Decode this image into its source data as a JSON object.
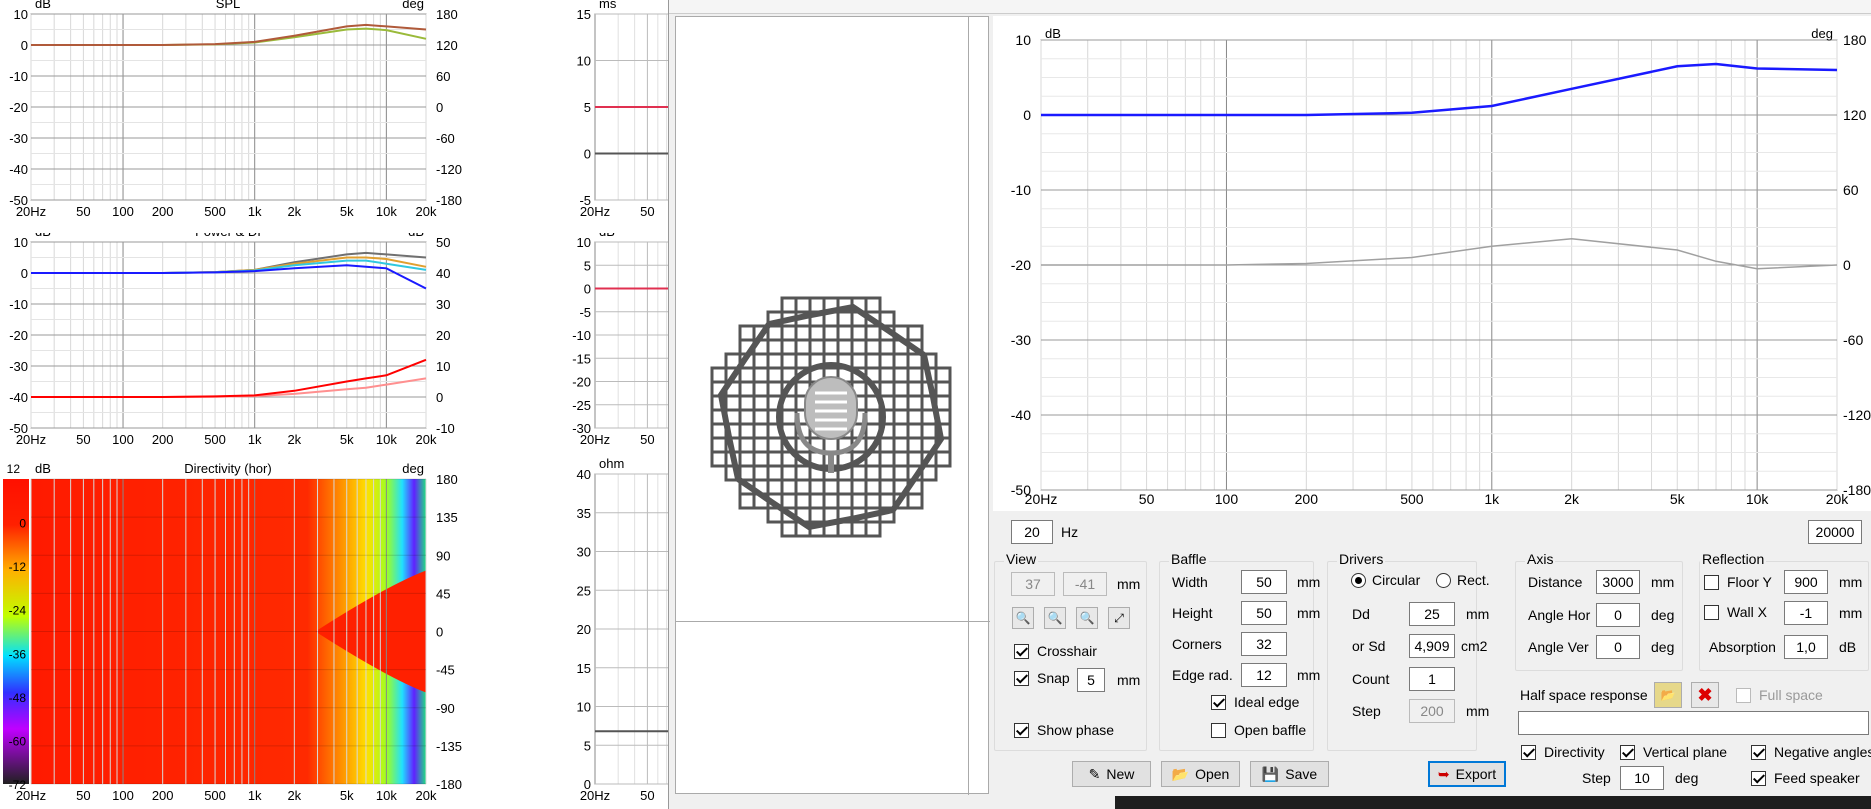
{
  "left_panels": {
    "spl": {
      "title": "SPL",
      "ylabel_left": "dB",
      "ylabel_right": "deg",
      "ylim": [
        -50,
        10
      ],
      "y_ticks": [
        "10",
        "0",
        "-10",
        "-20",
        "-30",
        "-40",
        "-50"
      ],
      "y2_ticks": [
        "180",
        "120",
        "60",
        "0",
        "-60",
        "-120",
        "-180"
      ],
      "x_ticks": [
        "20Hz",
        "50",
        "100",
        "200",
        "500",
        "1k",
        "2k",
        "5k",
        "10k",
        "20k"
      ]
    },
    "power": {
      "title": "Power & DI",
      "ylabel_left": "dB",
      "ylabel_right": "dB",
      "y_ticks": [
        "10",
        "0",
        "-10",
        "-20",
        "-30",
        "-40",
        "-50"
      ],
      "y2_ticks": [
        "50",
        "40",
        "30",
        "20",
        "10",
        "0",
        "-10"
      ],
      "x_ticks": [
        "20Hz",
        "50",
        "100",
        "200",
        "500",
        "1k",
        "2k",
        "5k",
        "10k",
        "20k"
      ]
    },
    "directivity": {
      "title": "Directivity (hor)",
      "ylabel_left": "dB",
      "ylabel_right": "deg",
      "scale_ticks": [
        "12",
        "0",
        "-12",
        "-24",
        "-36",
        "-48",
        "-60",
        "-72"
      ],
      "y2_ticks": [
        "180",
        "135",
        "90",
        "45",
        "0",
        "-45",
        "-90",
        "-135",
        "-180"
      ],
      "x_ticks": [
        "20Hz",
        "50",
        "100",
        "200",
        "500",
        "1k",
        "2k",
        "5k",
        "10k",
        "20k"
      ]
    },
    "group_delay": {
      "ylabel": "ms",
      "y_ticks": [
        "15",
        "10",
        "5",
        "0",
        "-5"
      ],
      "x_ticks": [
        "20Hz",
        "50"
      ]
    },
    "step": {
      "ylabel": "dB",
      "y_ticks": [
        "10",
        "5",
        "0",
        "-5",
        "-10",
        "-15",
        "-20",
        "-25",
        "-30"
      ],
      "x_ticks": [
        "20Hz",
        "50"
      ]
    },
    "impedance": {
      "ylabel": "ohm",
      "y_ticks": [
        "40",
        "35",
        "30",
        "25",
        "20",
        "15",
        "10",
        "5",
        "0"
      ],
      "x_ticks": [
        "20Hz",
        "50"
      ]
    }
  },
  "chart_data": [
    {
      "type": "line",
      "title": "SPL",
      "ylabel": "dB",
      "ylim": [
        -50,
        10
      ],
      "x": [
        20,
        50,
        100,
        200,
        500,
        1000,
        2000,
        5000,
        7000,
        10000,
        20000
      ],
      "series": [
        {
          "values": [
            0,
            0,
            0,
            0,
            0.3,
            1,
            3,
            6,
            6.5,
            6,
            5
          ]
        },
        {
          "values": [
            0,
            0,
            0,
            0,
            0.2,
            0.8,
            2.5,
            5,
            5.3,
            4.8,
            2
          ]
        }
      ]
    },
    {
      "type": "line",
      "title": "Power & DI",
      "ylabel": "dB",
      "ylim": [
        -50,
        10
      ],
      "x": [
        20,
        50,
        100,
        200,
        500,
        1000,
        2000,
        5000,
        7000,
        10000,
        20000
      ],
      "series": [
        {
          "values": [
            0,
            0,
            0,
            0,
            0.3,
            1,
            3,
            5,
            5,
            4.5,
            4
          ]
        },
        {
          "values": [
            0,
            0,
            0,
            0,
            0.2,
            0.6,
            1.5,
            2.5,
            2,
            1.5,
            -5
          ]
        },
        {
          "values": [
            -40,
            -40,
            -40,
            -40,
            -39.8,
            -39.5,
            -38,
            -35,
            -34,
            -33,
            -28
          ]
        }
      ]
    },
    {
      "type": "line",
      "ylabel": "dB",
      "ylim": [
        -50,
        10
      ],
      "x": [
        20,
        50,
        100,
        200,
        500,
        1000,
        2000,
        5000,
        7000,
        10000,
        20000
      ],
      "series": [
        {
          "values": [
            0,
            0,
            0,
            0,
            0.3,
            1.2,
            3.5,
            6.5,
            6.8,
            6.2,
            6
          ]
        },
        {
          "values": [
            -20,
            -20,
            -20,
            -19.8,
            -19,
            -17.5,
            -16.5,
            -18,
            -19.5,
            -20.5,
            -20
          ]
        }
      ]
    }
  ],
  "main_chart": {
    "ylabel_left": "dB",
    "ylabel_right": "deg",
    "y_ticks": [
      "10",
      "0",
      "-10",
      "-20",
      "-30",
      "-40",
      "-50"
    ],
    "y2_ticks": [
      "180",
      "120",
      "60",
      "0",
      "-60",
      "-120",
      "-180"
    ],
    "x_ticks": [
      "20Hz",
      "50",
      "100",
      "200",
      "500",
      "1k",
      "2k",
      "5k",
      "10k",
      "20k"
    ]
  },
  "freq": {
    "min": "20",
    "max": "20000",
    "unit": "Hz"
  },
  "view": {
    "title": "View",
    "x": "37",
    "y": "-41",
    "unit": "mm",
    "crosshair": "Crosshair",
    "snap": "Snap",
    "snap_val": "5",
    "snap_unit": "mm",
    "show_phase": "Show phase"
  },
  "baffle": {
    "title": "Baffle",
    "width_lbl": "Width",
    "width": "50",
    "height_lbl": "Height",
    "height": "50",
    "corners_lbl": "Corners",
    "corners": "32",
    "edge_lbl": "Edge rad.",
    "edge": "12",
    "unit": "mm",
    "ideal_edge": "Ideal edge",
    "open_baffle": "Open baffle"
  },
  "drivers": {
    "title": "Drivers",
    "circular": "Circular",
    "rect": "Rect.",
    "dd_lbl": "Dd",
    "dd": "25",
    "sd_lbl": "or Sd",
    "sd": "4,909",
    "sd_unit": "cm2",
    "count_lbl": "Count",
    "count": "1",
    "step_lbl": "Step",
    "step": "200",
    "unit": "mm"
  },
  "axis": {
    "title": "Axis",
    "distance_lbl": "Distance",
    "distance": "3000",
    "hor_lbl": "Angle Hor",
    "hor": "0",
    "ver_lbl": "Angle Ver",
    "ver": "0",
    "mm": "mm",
    "deg": "deg"
  },
  "reflection": {
    "title": "Reflection",
    "floor_lbl": "Floor Y",
    "floor": "900",
    "wall_lbl": "Wall  X",
    "wall": "-1",
    "abs_lbl": "Absorption",
    "abs": "1,0",
    "mm": "mm",
    "db": "dB"
  },
  "half_space": {
    "label": "Half space response",
    "full_space": "Full space",
    "path": ""
  },
  "options": {
    "directivity": "Directivity",
    "vertical": "Vertical plane",
    "negative": "Negative angles",
    "step_lbl": "Step",
    "step": "10",
    "deg": "deg",
    "feed": "Feed speaker"
  },
  "buttons": {
    "new": "New",
    "open": "Open",
    "save": "Save",
    "export": "Export"
  },
  "bottom_ticks": [
    "100",
    "200",
    "500",
    "1k",
    "2k",
    "5k",
    "10k",
    "20k"
  ],
  "colors": {
    "blue": "#1a1aff",
    "grey": "#a0a0a0",
    "red": "#ff0000",
    "olive": "#9aba3a",
    "brown": "#b05a3a"
  }
}
